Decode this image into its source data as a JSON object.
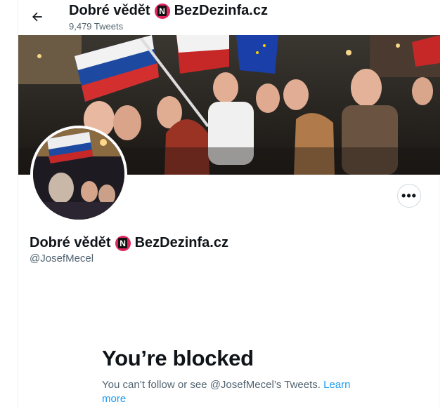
{
  "header": {
    "title": "Dobré vědět",
    "title_suffix": "BezDezinfa.cz",
    "tweet_count": "9,479 Tweets",
    "back_icon": "arrow-left-icon"
  },
  "profile": {
    "name": "Dobré vědět",
    "name_suffix": "BezDezinfa.cz",
    "handle": "@JosefMecel",
    "badge_letter": "N",
    "more_label": "•••"
  },
  "blocked": {
    "title": "You’re blocked",
    "message": "You can’t follow or see @JosefMecel’s Tweets.",
    "link": "Learn more"
  },
  "colors": {
    "accent": "#1d9bf0",
    "secondary_text": "#536471",
    "badge": "#e0245e"
  }
}
